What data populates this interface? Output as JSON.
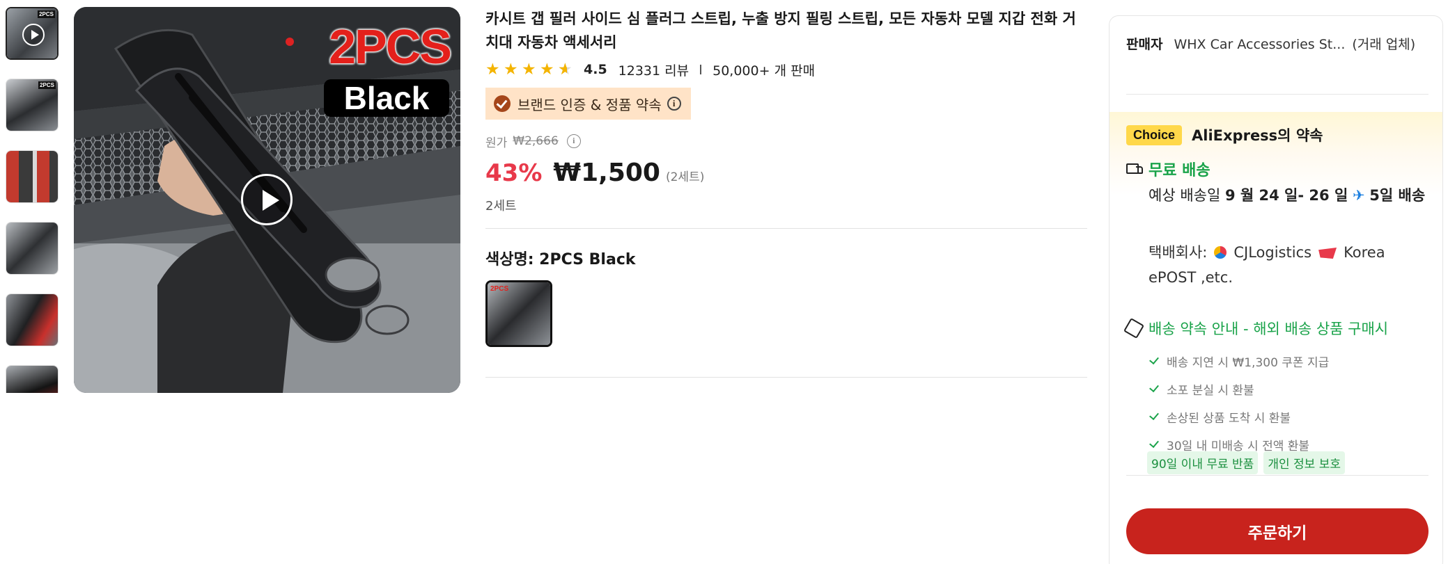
{
  "gallery": {
    "badge_main": "2PCS",
    "badge_color": "Black",
    "thumbnail_count": 6
  },
  "product": {
    "title": "카시트 갭 필러 사이드 심 플러그 스트립, 누출 방지 필링 스트립, 모든 자동차 모델 지갑 전화 거치대 자동차 액세서리",
    "rating": "4.5",
    "stars": 4.5,
    "reviews": "12331 리뷰",
    "sold": "50,000+ 개 판매",
    "brand_badge": "브랜드 인증 & 정품 약속",
    "original_label": "원가",
    "original_price": "₩2,666",
    "discount": "43%",
    "price": "₩1,500",
    "unit": "(2세트)",
    "set_text": "2세트",
    "color_label": "색상명: 2PCS Black",
    "swatch_tag": "2PCS"
  },
  "panel": {
    "seller_label": "판매자",
    "seller_name": "WHX Car Accessories St...",
    "seller_note": "(거래 업체)",
    "choice_badge": "Choice",
    "choice_title": "AliExpress의 약속",
    "free_shipping": "무료 배송",
    "est_prefix": "예상 배송일",
    "est_dates": "9 월 24 일- 26 일",
    "est_days": "5일 배송",
    "carrier_prefix": "택배회사:",
    "carrier_1": "CJLogistics",
    "carrier_2": "Korea ePOST ,etc.",
    "promise_title": "배송 약속 안내 - 해외 배송 상품 구매시",
    "promise_items": [
      "배송 지연 시 ₩1,300 쿠폰 지급",
      "소포 분실 시 환불",
      "손상된 상품 도착 시 환불",
      "30일 내 미배송 시 전액 환불"
    ],
    "tags": [
      "90일 이내 무료 반품",
      "개인 정보 보호"
    ],
    "order_button": "주문하기"
  },
  "colors": {
    "price_red": "#e8394a",
    "green": "#1aa34a",
    "order_button": "#c8231d",
    "choice_yellow": "#ffd84a",
    "brand_bg": "#ffe3c7"
  }
}
